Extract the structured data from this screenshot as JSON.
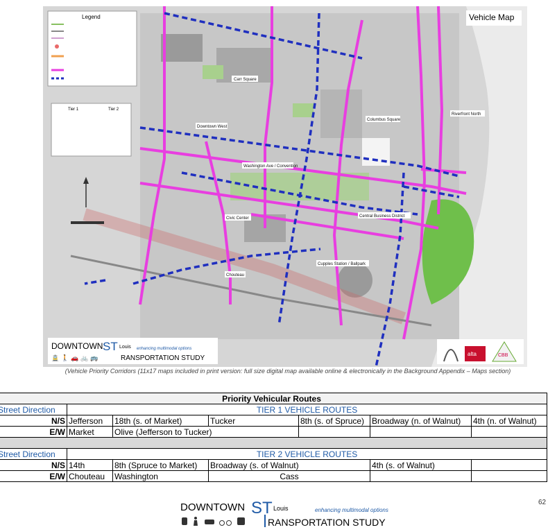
{
  "map": {
    "title": "Vehicle Map",
    "legend_title": "Legend",
    "labels": [
      "Carr Square",
      "Columbus Square",
      "Riverfront North",
      "Downtown West",
      "Washington Ave / Convention",
      "Civic Center",
      "Cupples Station / Ballpark",
      "Chouteau",
      "Central Business District"
    ],
    "tier_table": {
      "t1": "Tier 1",
      "t2": "Tier 2"
    },
    "logo": {
      "title_line1": "DOWNTOWN",
      "stl": "ST",
      "louis": "Louis",
      "tagline": "enhancing multimodal options",
      "title_line2": "RANSPORTATION STUDY",
      "icons": "🚊 🚶 🚗 🚲 🚌"
    },
    "partner_logo_text": "alta",
    "partner_logo_text_2": "CBB"
  },
  "caption": "(Vehicle Priority Corridors (11x17 maps included in print version: full size digital map available online & electronically in the Background  Appendix – Maps section)",
  "table": {
    "title": "Priority Vehicular Routes",
    "street_direction_label": "Street Direction",
    "tier1": {
      "header": "TIER 1 VEHICLE ROUTES",
      "ns": {
        "label": "N/S",
        "cells": [
          "Jefferson",
          "18th (s. of Market)",
          "Tucker",
          "8th (s. of Spruce)",
          "Broadway (n. of Walnut)",
          "4th (n. of Walnut)"
        ]
      },
      "ew": {
        "label": "E/W",
        "cells": [
          "Market",
          "Olive (Jefferson to Tucker)"
        ]
      }
    },
    "tier2": {
      "header": "TIER 2 VEHICLE ROUTES",
      "ns": {
        "label": "N/S",
        "cells": [
          "14th",
          "8th (Spruce to Market)",
          "Broadway (s. of Walnut)",
          "4th (s. of Walnut)"
        ]
      },
      "ew": {
        "label": "E/W",
        "cells": [
          "Chouteau",
          "Washington",
          "Cass"
        ]
      }
    }
  },
  "footer": {
    "title_line1": "DOWNTOWN",
    "stl": "ST",
    "louis": "Louis",
    "tagline": "enhancing multimodal options",
    "title_line2": "RANSPORTATION STUDY",
    "page": "62"
  }
}
